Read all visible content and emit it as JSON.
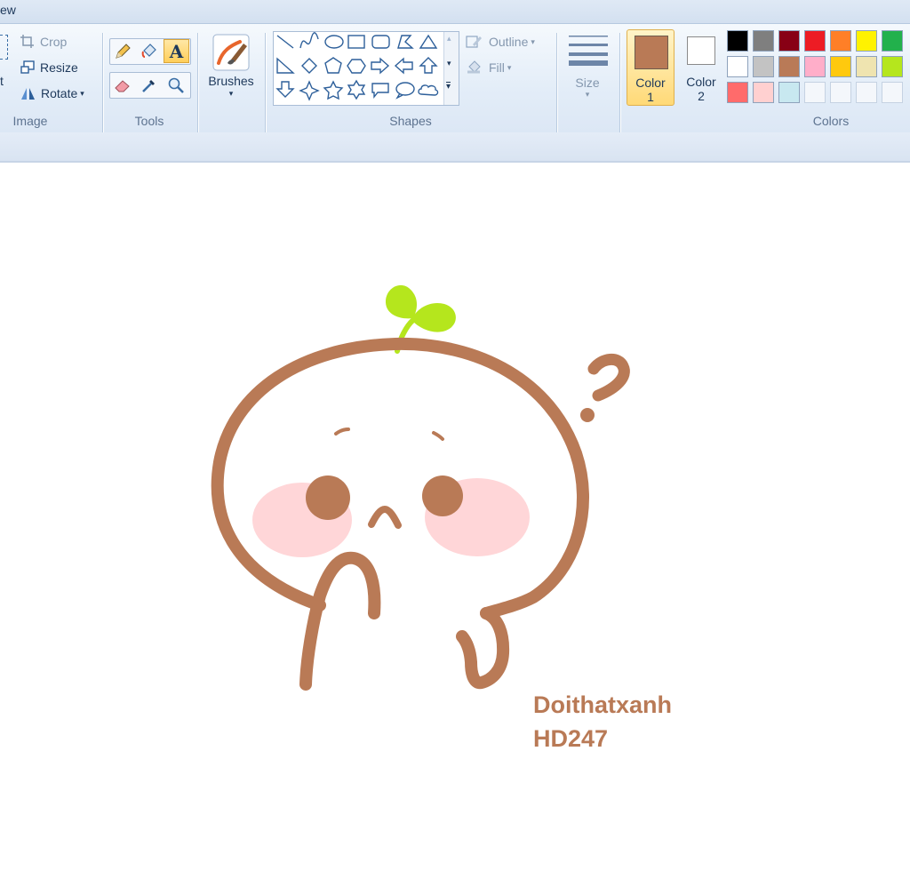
{
  "menu": {
    "view_tab": "ew"
  },
  "image_group": {
    "label": "Image",
    "select_stub": "t",
    "crop": "Crop",
    "resize": "Resize",
    "rotate": "Rotate"
  },
  "tools_group": {
    "label": "Tools"
  },
  "brushes": {
    "label": "Brushes"
  },
  "shapes_group": {
    "label": "Shapes",
    "outline": "Outline",
    "fill": "Fill"
  },
  "size": {
    "label": "Size"
  },
  "color1": {
    "label_line1": "Color",
    "label_line2": "1",
    "value": "#b97a56"
  },
  "color2": {
    "label_line1": "Color",
    "label_line2": "2",
    "value": "#ffffff"
  },
  "colors_group": {
    "label": "Colors",
    "palette": [
      "#000000",
      "#7f7f7f",
      "#880015",
      "#ed1c24",
      "#ff7f27",
      "#fff200",
      "#22b14c",
      "#ffffff",
      "#c3c3c3",
      "#b97a57",
      "#ffaec9",
      "#ffc90e",
      "#efe4b0",
      "#b5e61d",
      "#ff6b6b",
      "#ffd0d0",
      "#c8e8f0",
      "",
      "",
      "",
      ""
    ]
  },
  "canvas": {
    "watermark_line1": "Doithatxanh",
    "watermark_line2": "HD247"
  },
  "drawing_colors": {
    "outline": "#b97a56",
    "blush": "#ffd6d8",
    "sprout": "#b5e61d"
  }
}
